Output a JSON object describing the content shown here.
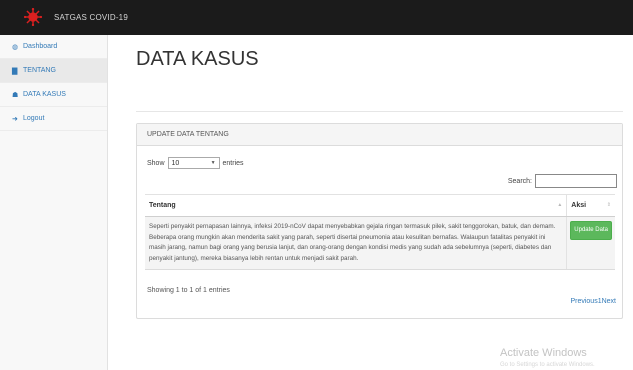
{
  "app": {
    "brand_name": "SATGAS COVID-19",
    "accent_color": "#d92020",
    "topbar_color": "#1b1b1b"
  },
  "sidebar": {
    "items": [
      {
        "label": "Dashboard",
        "icon": "dashboard-icon",
        "active": false
      },
      {
        "label": "TENTANG",
        "icon": "file-icon",
        "active": true
      },
      {
        "label": "DATA KASUS",
        "icon": "users-icon",
        "active": false
      },
      {
        "label": "Logout",
        "icon": "logout-icon",
        "active": false
      }
    ]
  },
  "page": {
    "title": "DATA KASUS"
  },
  "panel": {
    "heading": "UPDATE DATA TENTANG",
    "show_label": "Show",
    "entries_value": "10",
    "entries_label": "entries",
    "search_label": "Search:",
    "search_value": "",
    "columns": [
      "Tentang",
      "Aksi"
    ],
    "rows": [
      {
        "tentang": "Seperti penyakit pernapasan lainnya, infeksi 2019-nCoV dapat menyebabkan gejala ringan termasuk pilek, sakit tenggorokan, batuk, dan demam. Beberapa orang mungkin akan menderita sakit yang parah, seperti disertai pneumonia atau kesulitan bernafas. Walaupun fatalitas penyakit ini masih jarang, namun bagi orang yang berusia lanjut, dan orang-orang dengan kondisi medis yang sudah ada sebelumnya (seperti, diabetes dan penyakit jantung), mereka biasanya lebih rentan untuk menjadi sakit parah.",
        "action_label": "Update Data"
      }
    ],
    "info": "Showing 1 to 1 of 1 entries",
    "previous_label": "Previous",
    "page_number": "1",
    "next_label": "Next",
    "button_color": "#5cb85c"
  },
  "watermark": {
    "title": "Activate Windows",
    "subtitle": "Go to Settings to activate Windows."
  }
}
